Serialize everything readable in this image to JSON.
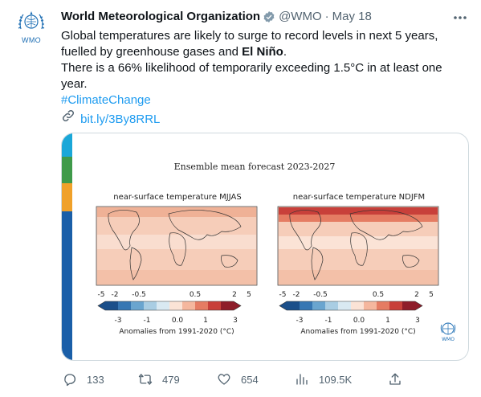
{
  "author": {
    "avatar_label": "WMO",
    "name": "World Meteorological Organization",
    "handle": "@WMO",
    "separator": "·",
    "date": "May 18"
  },
  "tweet": {
    "line1": "Global temperatures are likely to surge to record levels in next 5 years,",
    "line2_prefix": "fuelled by greenhouse gases and ",
    "line2_bold": "El Niño",
    "line2_suffix": ".",
    "line3": "There is a 66% likelihood of temporarily exceeding 1.5°C in at least one",
    "line4": "year.",
    "hashtag": "#ClimateChange",
    "link": "bit.ly/3By8RRL"
  },
  "media": {
    "stripe_colors": [
      "#1aa7d8",
      "#3f9a4a",
      "#f0a12a",
      "#1a5fa8"
    ],
    "title": "Ensemble mean forecast 2023-2027",
    "left_panel_title": "near-surface temperature MJJAS",
    "right_panel_title": "near-surface temperature NDJFM",
    "top_ticks": [
      "-5",
      "-2",
      "-0.5",
      "0.5",
      "2",
      "5"
    ],
    "bottom_ticks": [
      "-3",
      "-1",
      "0.0",
      "1",
      "3"
    ],
    "colorbar_label": "Anomalies from 1991-2020 (°C)",
    "colorbar_colors": [
      "#1b4f8a",
      "#3777b3",
      "#6aa5cf",
      "#a9cde3",
      "#d9e9f2",
      "#fbe3d6",
      "#f5b79e",
      "#e57c63",
      "#c8403a",
      "#8e1d2a"
    ],
    "logo_label": "WMO"
  },
  "actions": {
    "replies": "133",
    "retweets": "479",
    "likes": "654",
    "views": "109.5K"
  }
}
